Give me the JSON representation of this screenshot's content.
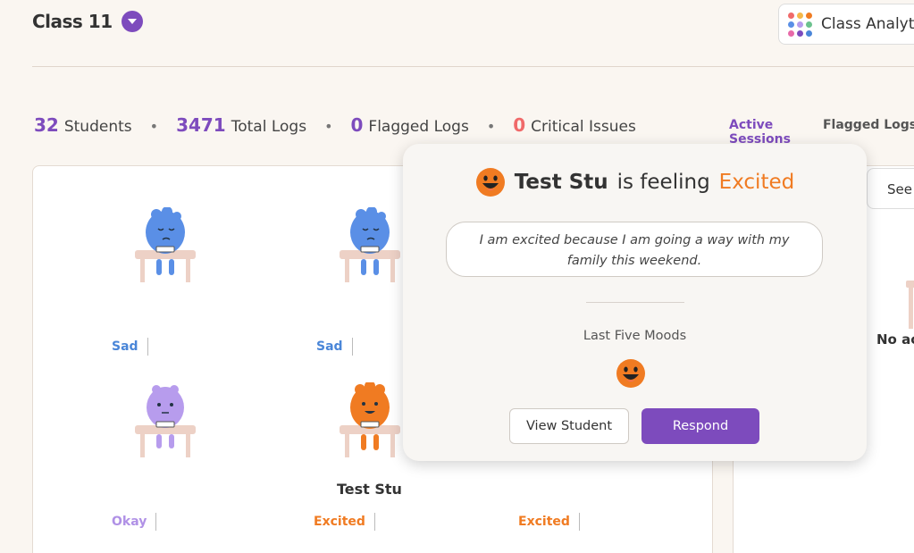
{
  "header": {
    "class_title": "Class 11",
    "analytics_label": "Class Analytics"
  },
  "stats": {
    "students_count": "32",
    "students_label": "Students",
    "logs_count": "3471",
    "logs_label": "Total Logs",
    "flagged_count": "0",
    "flagged_label": "Flagged Logs",
    "critical_count": "0",
    "critical_label": "Critical Issues",
    "separator": "•"
  },
  "tabs": {
    "active": "Active Sessions",
    "flagged": "Flagged Logs"
  },
  "students": [
    {
      "mood": "Sad",
      "color": "#4a86d8",
      "figure_color": "#5a8fe6",
      "name": ""
    },
    {
      "mood": "Sad",
      "color": "#4a86d8",
      "figure_color": "#5a8fe6",
      "name": ""
    },
    {
      "mood": "Okay",
      "color": "#b091e6",
      "figure_color": "#b79ced",
      "name": ""
    },
    {
      "mood": "Excited",
      "color": "#f07b22",
      "figure_color": "#f07b22",
      "name": "Test Stu"
    },
    {
      "mood": "Excited",
      "color": "#f07b22",
      "figure_color": "#f07b22",
      "name": ""
    }
  ],
  "right_panel": {
    "see_label": "See",
    "no_activity": "No ac"
  },
  "popover": {
    "student_name": "Test Stu",
    "feeling_prefix": "is feeling",
    "feeling": "Excited",
    "quote": "I am excited because I am going a way with my family this weekend.",
    "last_five_label": "Last Five Moods",
    "view_button": "View Student",
    "respond_button": "Respond",
    "accent_color": "#f07b22"
  },
  "colors": {
    "brand": "#7d4bbd",
    "critical": "#f06a6a",
    "sad": "#4a86d8",
    "okay": "#b091e6",
    "excited": "#f07b22"
  }
}
